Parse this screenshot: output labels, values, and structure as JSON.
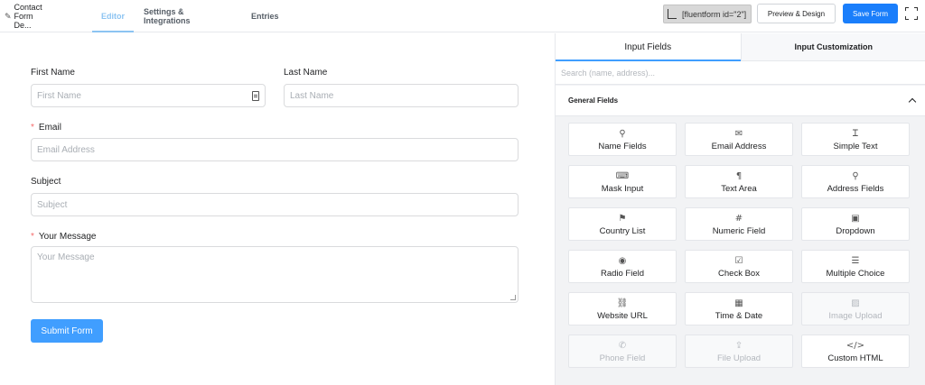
{
  "nav": {
    "form_title": "Contact Form De...",
    "tabs": [
      "Editor",
      "Settings & Integrations",
      "Entries"
    ]
  },
  "toolbar": {
    "shortcode": "[fluentform id=\"2\"]",
    "preview_label": "Preview & Design",
    "save_label": "Save Form"
  },
  "form": {
    "first_name": {
      "label": "First Name",
      "placeholder": "First Name"
    },
    "last_name": {
      "label": "Last Name",
      "placeholder": "Last Name"
    },
    "email": {
      "label": "Email",
      "placeholder": "Email Address",
      "required": "*"
    },
    "subject": {
      "label": "Subject",
      "placeholder": "Subject"
    },
    "message": {
      "label": "Your Message",
      "placeholder": "Your Message",
      "required": "*"
    },
    "submit_label": "Submit Form"
  },
  "sidebar": {
    "tabs": {
      "input_fields": "Input Fields",
      "input_customization": "Input Customization"
    },
    "search_placeholder": "Search (name, address)...",
    "group_title": "General Fields",
    "fields": [
      {
        "label": "Name Fields",
        "icon": "person-icon",
        "glyph": "⚲"
      },
      {
        "label": "Email Address",
        "icon": "envelope-icon",
        "glyph": "✉"
      },
      {
        "label": "Simple Text",
        "icon": "text-icon",
        "glyph": "Ꮖ"
      },
      {
        "label": "Mask Input",
        "icon": "keyboard-icon",
        "glyph": "⌨"
      },
      {
        "label": "Text Area",
        "icon": "paragraph-icon",
        "glyph": "¶"
      },
      {
        "label": "Address Fields",
        "icon": "map-pin-icon",
        "glyph": "⚲"
      },
      {
        "label": "Country List",
        "icon": "flag-icon",
        "glyph": "⚑"
      },
      {
        "label": "Numeric Field",
        "icon": "hash-icon",
        "glyph": "#"
      },
      {
        "label": "Dropdown",
        "icon": "dropdown-icon",
        "glyph": "▣"
      },
      {
        "label": "Radio Field",
        "icon": "radio-icon",
        "glyph": "◉"
      },
      {
        "label": "Check Box",
        "icon": "checkbox-icon",
        "glyph": "☑"
      },
      {
        "label": "Multiple Choice",
        "icon": "list-icon",
        "glyph": "☰"
      },
      {
        "label": "Website URL",
        "icon": "link-icon",
        "glyph": "⛓"
      },
      {
        "label": "Time & Date",
        "icon": "calendar-icon",
        "glyph": "▦"
      },
      {
        "label": "Image Upload",
        "icon": "image-icon",
        "glyph": "▨",
        "disabled": true
      },
      {
        "label": "Phone Field",
        "icon": "phone-icon",
        "glyph": "✆",
        "disabled": true
      },
      {
        "label": "File Upload",
        "icon": "upload-icon",
        "glyph": "⇪",
        "disabled": true
      },
      {
        "label": "Custom HTML",
        "icon": "code-icon",
        "glyph": "</>"
      }
    ]
  }
}
